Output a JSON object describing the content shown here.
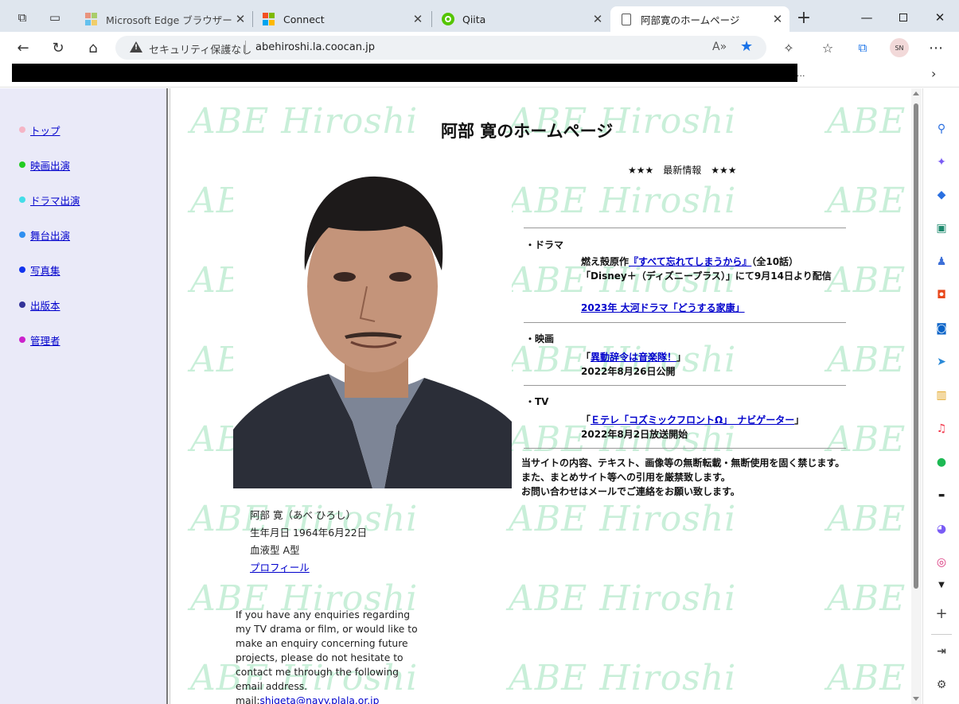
{
  "browser": {
    "tabs": [
      {
        "title": "Microsoft Edge ブラウザー ポリシー"
      },
      {
        "title": "Connect"
      },
      {
        "title": "Qiita"
      },
      {
        "title": "阿部寛のホームページ"
      }
    ],
    "address": {
      "security_label": "セキュリティ保護なし",
      "url": "abehiroshi.la.coocan.jp"
    },
    "profile_initials": "SN",
    "favorites_overflow": "..."
  },
  "sidebar_nav": {
    "items": [
      {
        "label": "トップ",
        "color": "#f5b5c5"
      },
      {
        "label": "映画出演",
        "color": "#22cc22"
      },
      {
        "label": "ドラマ出演",
        "color": "#44dde8"
      },
      {
        "label": "舞台出演",
        "color": "#2f8ff0"
      },
      {
        "label": "写真集",
        "color": "#1133ee"
      },
      {
        "label": "出版本",
        "color": "#333399"
      },
      {
        "label": "管理者",
        "color": "#cc22cc"
      }
    ]
  },
  "watermark": "ABE Hiroshi",
  "page": {
    "title": "阿部 寛のホームページ",
    "news_heading": "★★★　最新情報　★★★",
    "drama": {
      "label": "・ドラマ",
      "line1_prefix": "燃え殻原作",
      "line1_link": "『すべて忘れてしまうから』",
      "line1_suffix": "（全10話）",
      "line2": "「Disney＋（ディズニープラス）」にて9月14日より配信",
      "link2": "2023年 大河ドラマ「どうする家康」"
    },
    "movie": {
      "label": "・映画",
      "open": "「",
      "link": "異動辞令は音楽隊！",
      "close": "」",
      "date": "2022年8月26日公開"
    },
    "tv": {
      "label": "・TV",
      "open": "「",
      "link": "Ｅテレ「コズミックフロントΩ」　ナビゲーター",
      "close": "」",
      "date": "2022年8月2日放送開始"
    },
    "notice": [
      "当サイトの内容、テキスト、画像等の無断転載・無断使用を固く禁じます。",
      "また、まとめサイト等への引用を厳禁致します。",
      "お問い合わせはメールでご連絡をお願い致します。"
    ],
    "profile": {
      "name": "阿部 寛（あべ ひろし）",
      "birthday": "生年月日 1964年6月22日",
      "blood": "血液型 A型",
      "link": "プロフィール"
    },
    "english": "If you have any enquiries regarding my TV drama or film, or would like to make an enquiry concerning future projects, please do not hesitate to contact me through the following email address.",
    "mail_prefix": "mail:",
    "mail_address": "shigeta@navy.plala.or.jp"
  }
}
